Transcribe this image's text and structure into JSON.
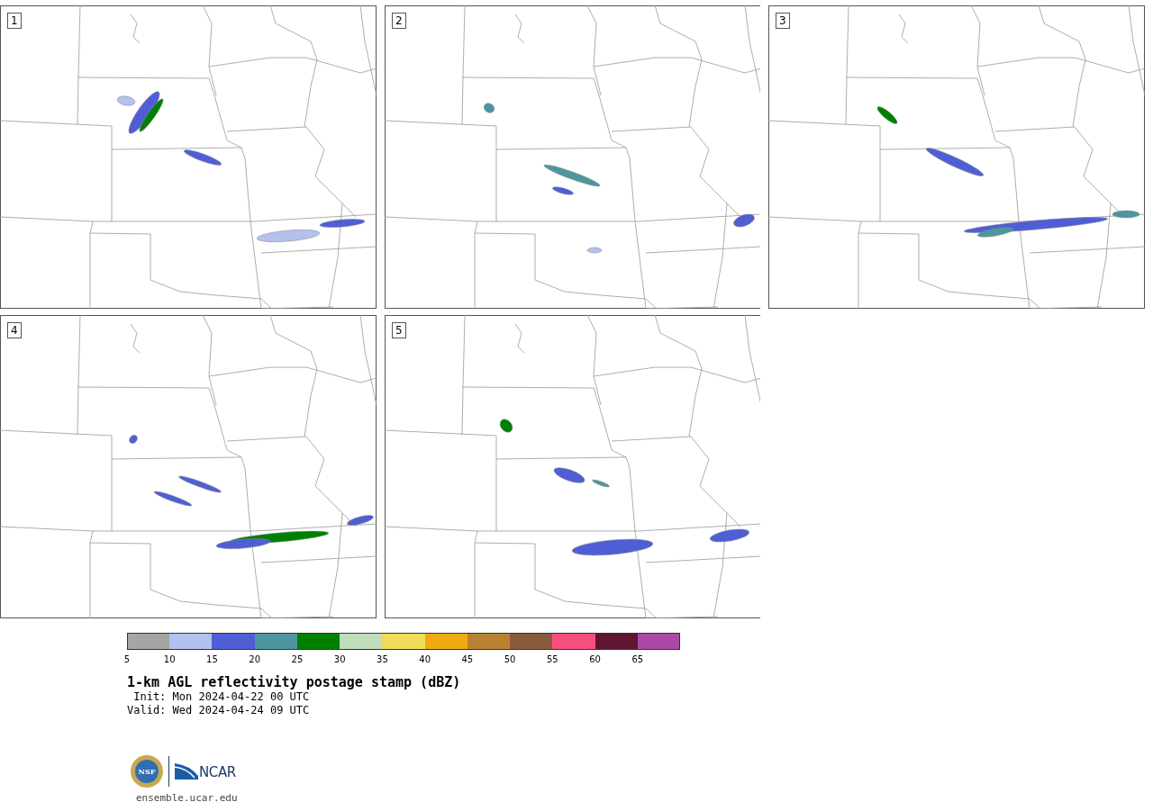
{
  "panels": [
    {
      "label": "1"
    },
    {
      "label": "2"
    },
    {
      "label": "3"
    },
    {
      "label": "4"
    },
    {
      "label": "5"
    }
  ],
  "colorbar": {
    "segments": [
      {
        "color": "#a5a5a5",
        "label": "5"
      },
      {
        "color": "#b4c0ee",
        "label": "10"
      },
      {
        "color": "#505ed6",
        "label": "15"
      },
      {
        "color": "#4e969d",
        "label": "20"
      },
      {
        "color": "#008000",
        "label": "25"
      },
      {
        "color": "#bedebe",
        "label": "30"
      },
      {
        "color": "#f0dc5a",
        "label": "35"
      },
      {
        "color": "#f0aa14",
        "label": "40"
      },
      {
        "color": "#b98232",
        "label": "45"
      },
      {
        "color": "#8a5a3e",
        "label": "50"
      },
      {
        "color": "#f64f7d",
        "label": "55"
      },
      {
        "color": "#5f1632",
        "label": "60"
      },
      {
        "color": "#ab4aa6",
        "label": "65"
      }
    ]
  },
  "title": "1-km AGL reflectivity postage stamp (dBZ)",
  "init": " Init: Mon 2024-04-22 00 UTC",
  "valid": "Valid: Wed 2024-04-24 09 UTC",
  "logos": {
    "nsf_text": "NSF",
    "ncar_text": "NCAR"
  },
  "url": "ensemble.ucar.edu"
}
